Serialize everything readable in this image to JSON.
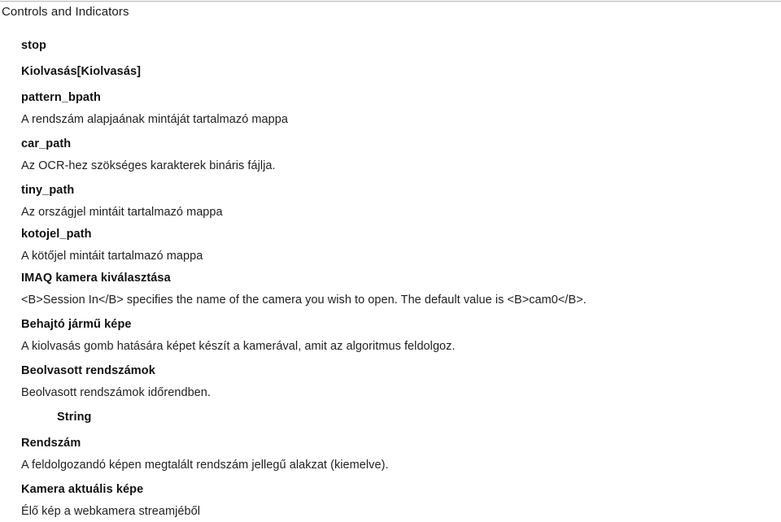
{
  "document": {
    "title": "Controls and Indicators",
    "entries": [
      {
        "term": "stop",
        "desc": "",
        "indent": "normal"
      },
      {
        "term": "Kiolvasás[Kiolvasás]",
        "desc": "",
        "indent": "normal"
      },
      {
        "term": "pattern_bpath",
        "desc": "A rendszám alapjaának mintáját tartalmazó mappa",
        "indent": "normal"
      },
      {
        "term": "car_path",
        "desc": "Az OCR-hez szökséges karakterek bináris fájlja.",
        "indent": "normal"
      },
      {
        "term": "tiny_path",
        "desc": "Az országjel mintáit tartalmazó mappa",
        "indent": "normal"
      },
      {
        "term": "kotojel_path",
        "desc": "A kötőjel mintáit tartalmazó mappa",
        "indent": "normal"
      },
      {
        "term": "IMAQ kamera kiválasztása",
        "desc": "<B>Session In</B> specifies the name of the camera you wish to open. The default value is <B>cam0</B>.",
        "indent": "normal"
      },
      {
        "term": "Behajtó jármű képe",
        "desc": "A kiolvasás gomb hatására képet készít a kamerával, amit az algoritmus feldolgoz.",
        "indent": "normal"
      },
      {
        "term": "Beolvasott rendszámok",
        "desc": "Beolvasott rendszámok időrendben.",
        "indent": "normal"
      },
      {
        "term": "String",
        "desc": "",
        "indent": "deep"
      },
      {
        "term": "Rendszám",
        "desc": "A feldolgozandó képen megtalált rendszám jellegű alakzat (kiemelve).",
        "indent": "normal"
      },
      {
        "term": "Kamera aktuális képe",
        "desc": "Élő kép a webkamera streamjéből",
        "indent": "normal"
      }
    ]
  }
}
